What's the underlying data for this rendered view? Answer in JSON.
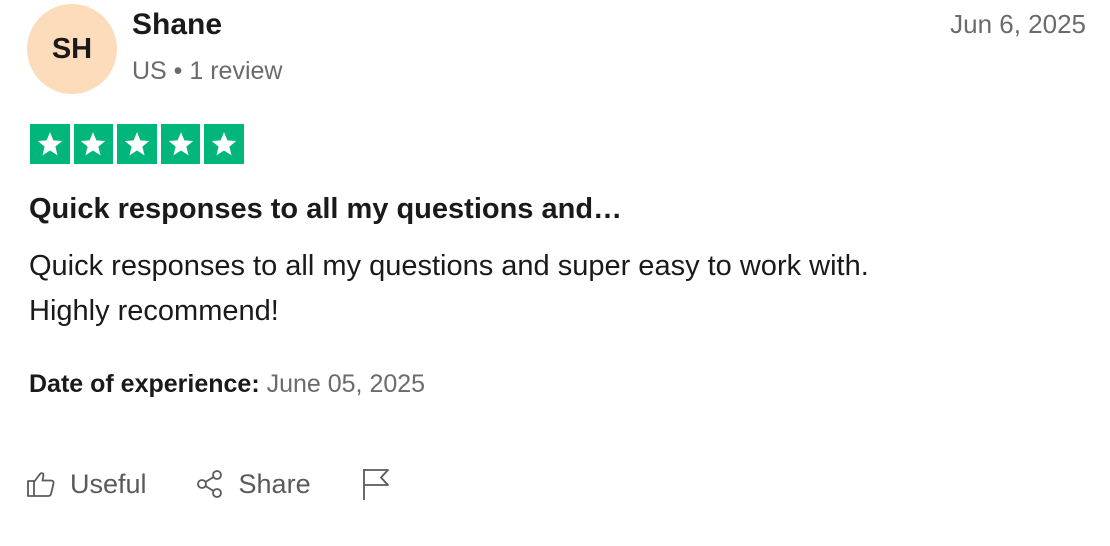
{
  "reviewer": {
    "initials": "SH",
    "name": "Shane",
    "meta": "US • 1 review",
    "avatar_color": "#fddcbc"
  },
  "review": {
    "date": "Jun 6, 2025",
    "rating": 5,
    "rating_max": 5,
    "star_color": "#00b67a",
    "title": "Quick responses to all my questions and…",
    "body_line1": "Quick responses to all my questions and super easy to work with.",
    "body_line2": "Highly recommend!",
    "experience_label": "Date of experience:",
    "experience_date": "June 05, 2025"
  },
  "actions": {
    "useful_label": "Useful",
    "useful_icon": "thumbs-up-icon",
    "share_label": "Share",
    "share_icon": "share-icon",
    "report_icon": "flag-icon"
  }
}
